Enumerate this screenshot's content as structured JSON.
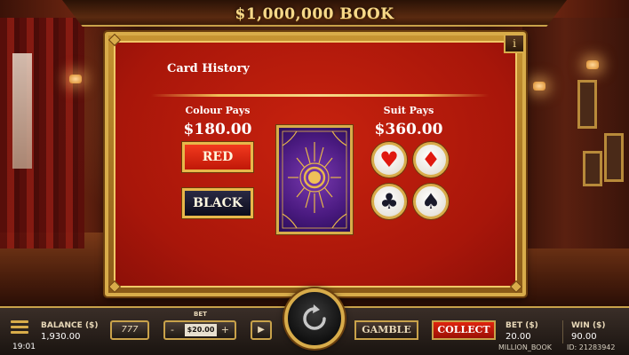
{
  "game": {
    "title": "$1,000,000 BOOK"
  },
  "panel": {
    "heading": "Card History",
    "colour": {
      "label": "Colour Pays",
      "amount": "$180.00",
      "red_label": "RED",
      "black_label": "BLACK"
    },
    "suit": {
      "label": "Suit Pays",
      "amount": "$360.00",
      "suits": [
        {
          "name": "hearts",
          "glyph": "♥",
          "color": "#e0180e"
        },
        {
          "name": "diamonds",
          "glyph": "♦",
          "color": "#e0180e"
        },
        {
          "name": "clubs",
          "glyph": "♣",
          "color": "#1a1a2a"
        },
        {
          "name": "spades",
          "glyph": "♠",
          "color": "#1a1a2a"
        }
      ]
    },
    "info_label": "i"
  },
  "bottom_bar": {
    "time": "19:01",
    "balance_label": "BALANCE ($)",
    "balance_value": "1,930.00",
    "autoplay_label": "777",
    "bet_title": "BET",
    "bet_value": "$20.00",
    "bet_minus": "-",
    "bet_plus": "+",
    "play_label": "▶",
    "gamble_label": "GAMBLE",
    "collect_label": "COLLECT",
    "bet_label": "BET ($)",
    "bet_amount": "20.00",
    "win_label": "WIN ($)",
    "win_value": "90.00",
    "game_id_name": "MILLION_BOOK",
    "session_id": "ID: 21283942"
  },
  "colors": {
    "panel_red": "#b81a0c",
    "gold": "#d8ac4a",
    "collect_red": "#e0240e"
  }
}
